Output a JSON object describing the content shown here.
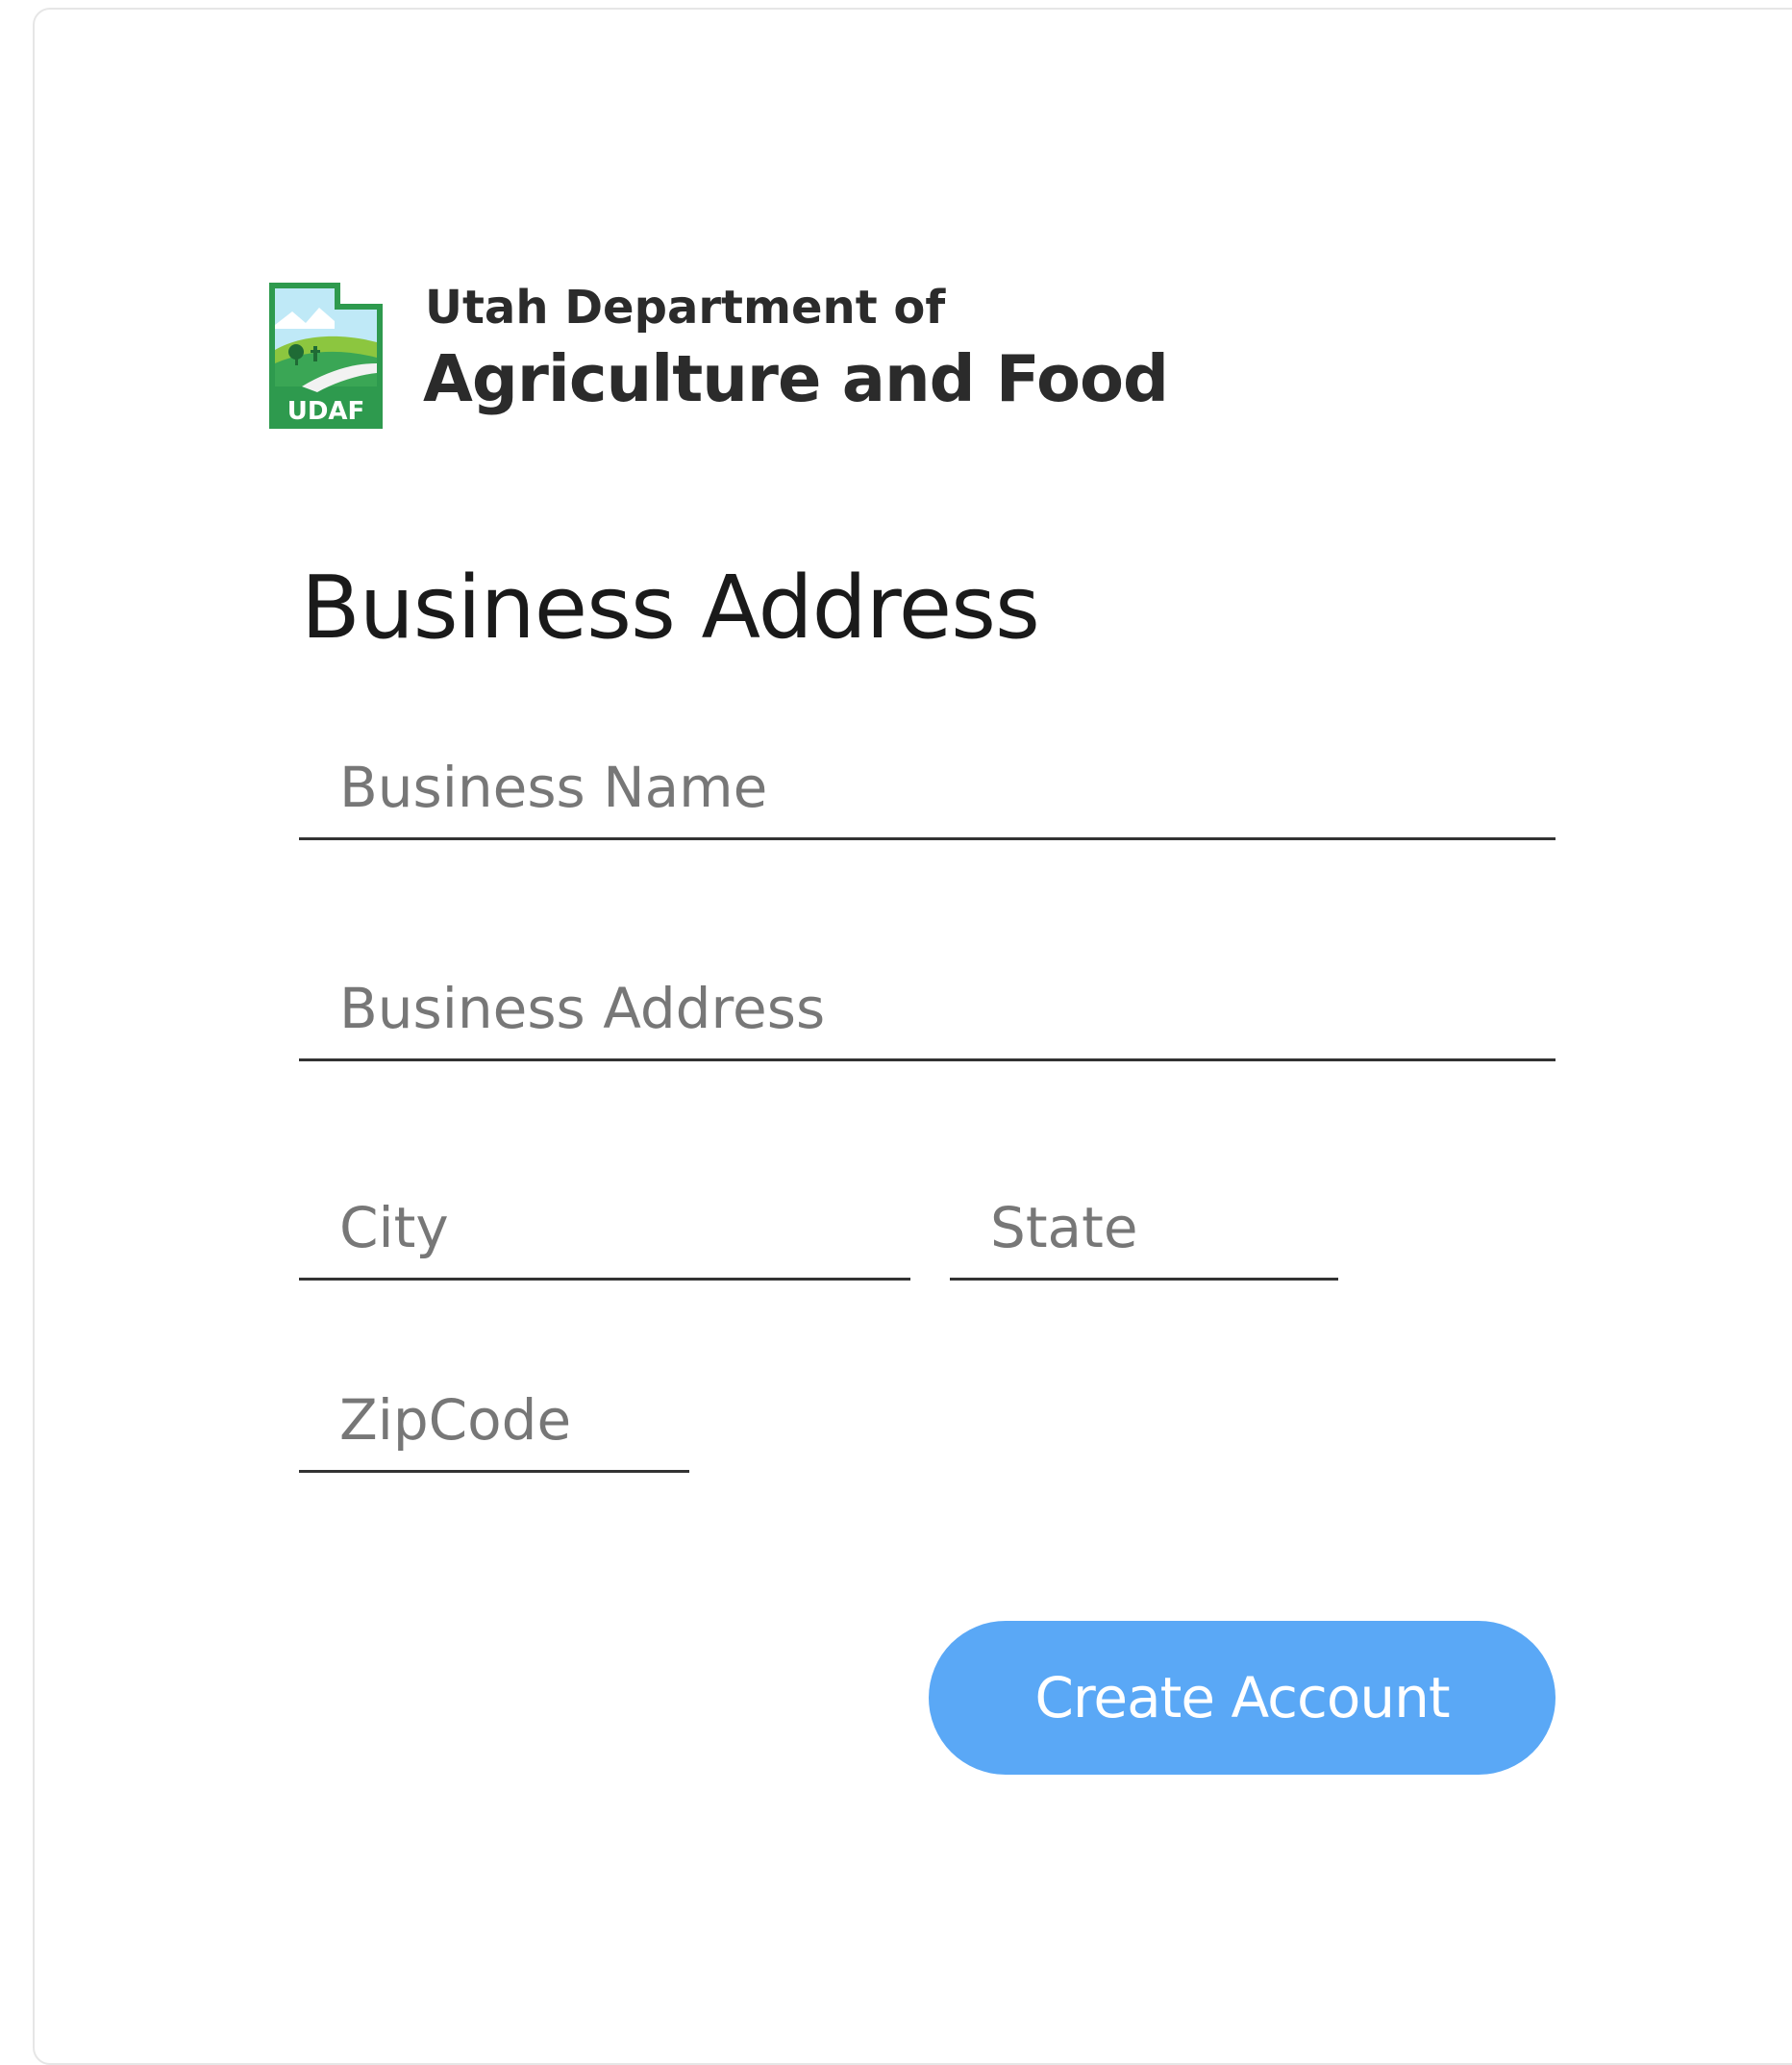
{
  "header": {
    "logo_text": "UDAF",
    "org_line1": "Utah Department of",
    "org_line2": "Agriculture and Food"
  },
  "form": {
    "title": "Business Address",
    "business_name": {
      "placeholder": "Business Name",
      "value": ""
    },
    "business_address": {
      "placeholder": "Business Address",
      "value": ""
    },
    "city": {
      "placeholder": "City",
      "value": ""
    },
    "state": {
      "placeholder": "State",
      "value": ""
    },
    "zipcode": {
      "placeholder": "ZipCode",
      "value": ""
    },
    "submit_label": "Create Account"
  },
  "colors": {
    "button": "#5aa8f6",
    "logo_green": "#2e9a4e",
    "logo_sky": "#8fd3f0"
  }
}
